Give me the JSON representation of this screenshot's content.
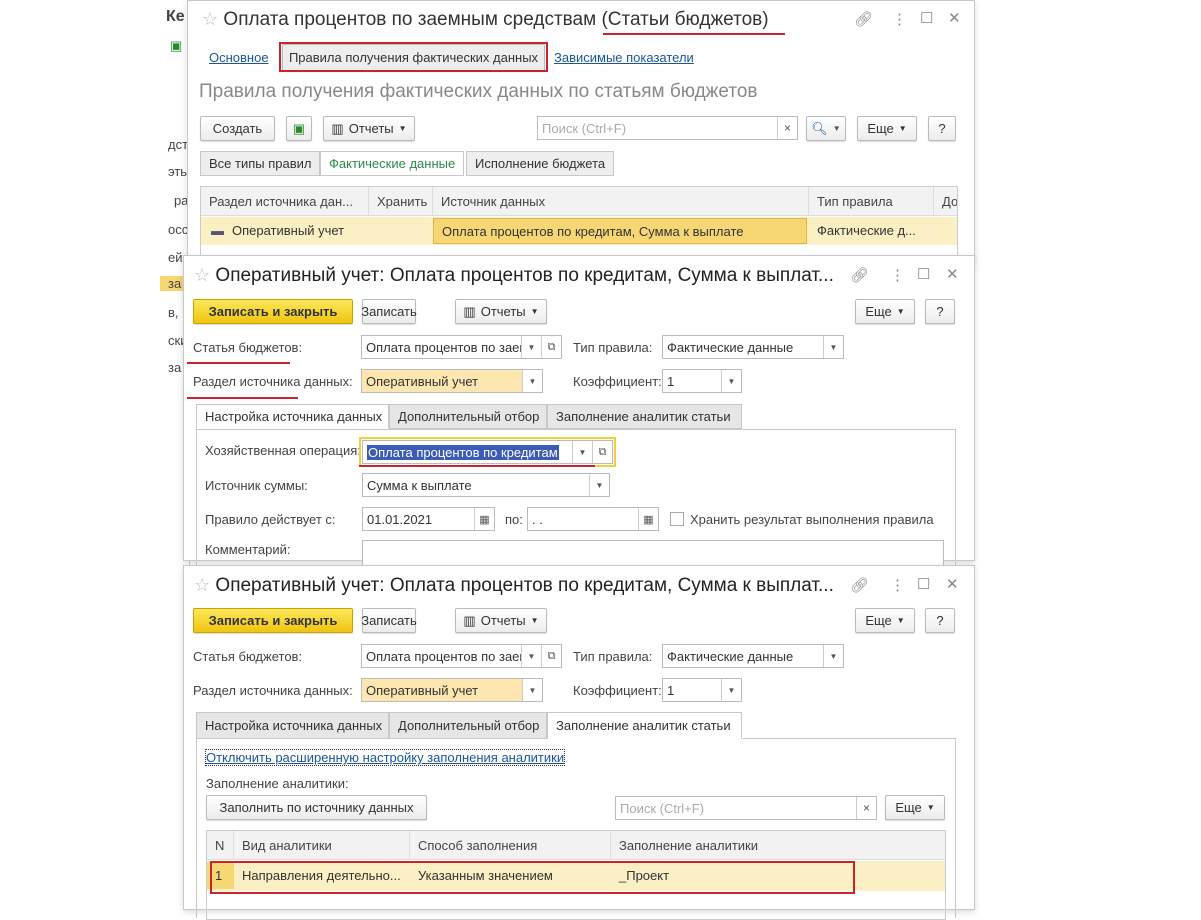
{
  "background": {
    "fragments": [
      "Ке",
      "дст",
      "эть",
      "ра",
      "осс",
      "ей",
      "за",
      "в,",
      "ски",
      "за"
    ]
  },
  "win1": {
    "title": "Оплата процентов по заемным средствам (Статьи бюджетов)",
    "nav": [
      "Основное",
      "Правила получения фактических данных",
      "Зависимые показатели"
    ],
    "heading": "Правила получения фактических данных по статьям бюджетов",
    "toolbar": {
      "create": "Создать",
      "reports": "Отчеты",
      "search_placeholder": "Поиск (Ctrl+F)",
      "clear": "×",
      "more": "Еще",
      "help": "?"
    },
    "filters": [
      "Все типы правил",
      "Фактические данные",
      "Исполнение бюджета"
    ],
    "columns": [
      "Раздел источника дан...",
      "Хранить",
      "Источник данных",
      "Тип правила",
      "До"
    ],
    "rows": [
      {
        "section": "Оперативный учет",
        "store": "",
        "source": "Оплата процентов по кредитам, Сумма к выплате",
        "type": "Фактические д..."
      }
    ]
  },
  "win2": {
    "title": "Оперативный учет: Оплата процентов по кредитам, Сумма к выплат...",
    "save_close": "Записать и закрыть",
    "save": "Записать",
    "reports": "Отчеты",
    "more": "Еще",
    "help": "?",
    "budget_item_label": "Статья бюджетов:",
    "budget_item_value": "Оплата процентов по заем",
    "rule_type_label": "Тип правила:",
    "rule_type_value": "Фактические данные",
    "section_label": "Раздел источника данных:",
    "section_value": "Оперативный учет",
    "coef_label": "Коэффициент:",
    "coef_value": "1",
    "tabs": [
      "Настройка источника данных",
      "Дополнительный отбор",
      "Заполнение аналитик статьи"
    ],
    "operation_label": "Хозяйственная операция:",
    "operation_value": "Оплата процентов по кредитам",
    "amount_label": "Источник суммы:",
    "amount_value": "Сумма к выплате",
    "from_label": "Правило действует с:",
    "from_value": "01.01.2021",
    "to_label": "по:",
    "to_value": " .  .",
    "store_label": "Хранить результат выполнения правила",
    "store_checked": false,
    "comment_label": "Комментарий:",
    "comment_value": ""
  },
  "win3": {
    "title": "Оперативный учет: Оплата процентов по кредитам, Сумма к выплат...",
    "save_close": "Записать и закрыть",
    "save": "Записать",
    "reports": "Отчеты",
    "more": "Еще",
    "help": "?",
    "budget_item_label": "Статья бюджетов:",
    "budget_item_value": "Оплата процентов по заем",
    "rule_type_label": "Тип правила:",
    "rule_type_value": "Фактические данные",
    "section_label": "Раздел источника данных:",
    "section_value": "Оперативный учет",
    "coef_label": "Коэффициент:",
    "coef_value": "1",
    "tabs": [
      "Настройка источника данных",
      "Дополнительный отбор",
      "Заполнение аналитик статьи"
    ],
    "disable_link": "Отключить расширенную настройку заполнения аналитики",
    "fill_label": "Заполнение аналитики:",
    "fill_button": "Заполнить по источнику данных",
    "search_placeholder": "Поиск (Ctrl+F)",
    "clear": "×",
    "more2": "Еще",
    "columns": [
      "N",
      "Вид аналитики",
      "Способ заполнения",
      "Заполнение аналитики"
    ],
    "rows": [
      {
        "n": "1",
        "kind": "Направления деятельно...",
        "method": "Указанным значением",
        "value": "_Проект"
      }
    ]
  },
  "colors": {
    "accent_yellow": "#f1c40f",
    "highlight_red": "#c8242e",
    "selected_row": "#fbf0c4",
    "link": "#1a56a0"
  }
}
